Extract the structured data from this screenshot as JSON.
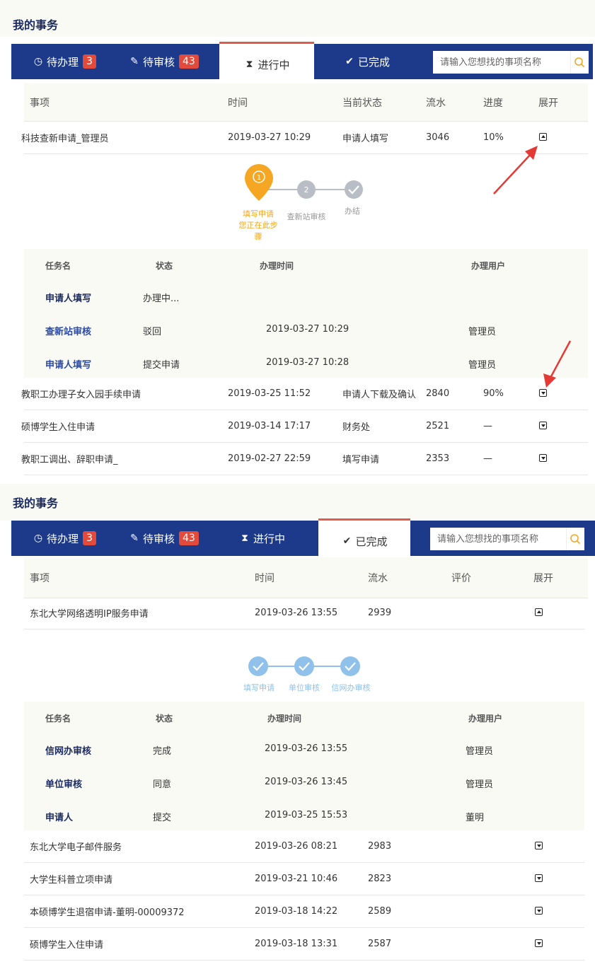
{
  "panel1": {
    "heading": "我的事务",
    "tabs": [
      {
        "label": "待办理",
        "badge": "3",
        "icon": "clock-icon"
      },
      {
        "label": "待审核",
        "badge": "43",
        "icon": "edit-icon"
      },
      {
        "label": "进行中",
        "icon": "hourglass-icon"
      },
      {
        "label": "已完成",
        "icon": "check-icon"
      }
    ],
    "search_placeholder": "请输入您想找的事项名称",
    "columns": [
      "事项",
      "时间",
      "当前状态",
      "流水",
      "进度",
      "展开"
    ],
    "rows": [
      {
        "item": "科技查新申请_管理员",
        "time": "2019-03-27 10:29",
        "status": "申请人填写",
        "serial": "3046",
        "progress": "10%"
      },
      {
        "item": "教职工办理子女入园手续申请",
        "time": "2019-03-25 11:52",
        "status": "申请人下载及确认",
        "serial": "2840",
        "progress": "90%"
      },
      {
        "item": "硕博学生入住申请",
        "time": "2019-03-14 17:17",
        "status": "财务处",
        "serial": "2521",
        "progress": "—"
      },
      {
        "item": "教职工调出、辞职申请_",
        "time": "2019-02-27 22:59",
        "status": "填写申请",
        "serial": "2353",
        "progress": "—"
      }
    ],
    "steps": [
      {
        "num": "1",
        "label": "填写申请",
        "note": "您正在此步骤"
      },
      {
        "num": "2",
        "label": "查新站审核"
      },
      {
        "label": "办结"
      }
    ],
    "step_note_lines": [
      "您正在此步",
      "骤"
    ],
    "sub_columns": [
      "任务名",
      "状态",
      "办理时间",
      "办理用户"
    ],
    "sub_rows": [
      {
        "task": "申请人填写",
        "state": "办理中...",
        "time": "",
        "user": ""
      },
      {
        "task": "查新站审核",
        "state": "驳回",
        "time": "2019-03-27 10:29",
        "user": "管理员"
      },
      {
        "task": "申请人填写",
        "state": "提交申请",
        "time": "2019-03-27 10:28",
        "user": "管理员"
      }
    ]
  },
  "panel2": {
    "heading": "我的事务",
    "tabs": [
      {
        "label": "待办理",
        "badge": "3",
        "icon": "clock-icon"
      },
      {
        "label": "待审核",
        "badge": "43",
        "icon": "edit-icon"
      },
      {
        "label": "进行中",
        "icon": "hourglass-icon"
      },
      {
        "label": "已完成",
        "icon": "check-icon"
      }
    ],
    "search_placeholder": "请输入您想找的事项名称",
    "columns": [
      "事项",
      "时间",
      "流水",
      "评价",
      "展开"
    ],
    "rows": [
      {
        "item": "东北大学网络透明IP服务申请",
        "time": "2019-03-26 13:55",
        "serial": "2939"
      },
      {
        "item": "东北大学电子邮件服务",
        "time": "2019-03-26 08:21",
        "serial": "2983"
      },
      {
        "item": "大学生科普立项申请",
        "time": "2019-03-21 10:46",
        "serial": "2823"
      },
      {
        "item": "本硕博学生退宿申请-董明-00009372",
        "time": "2019-03-18 14:22",
        "serial": "2589"
      },
      {
        "item": "硕博学生入住申请",
        "time": "2019-03-18 13:31",
        "serial": "2587"
      }
    ],
    "steps": [
      {
        "label": "填写申请"
      },
      {
        "label": "单位审核"
      },
      {
        "label": "信网办审核"
      }
    ],
    "sub_columns": [
      "任务名",
      "状态",
      "办理时间",
      "办理用户"
    ],
    "sub_rows": [
      {
        "task": "信网办审核",
        "state": "完成",
        "time": "2019-03-26 13:55",
        "user": "管理员"
      },
      {
        "task": "单位审核",
        "state": "同意",
        "time": "2019-03-26 13:45",
        "user": "管理员"
      },
      {
        "task": "申请人",
        "state": "提交",
        "time": "2019-03-25 15:53",
        "user": "董明"
      }
    ]
  },
  "colors": {
    "tabbar": "#1d3a8a",
    "badge": "#e24a3b",
    "active_step": "#f5a623",
    "done_step": "#8fc1ea",
    "pending_step": "#b9bec6",
    "arrow": "#e53935"
  }
}
